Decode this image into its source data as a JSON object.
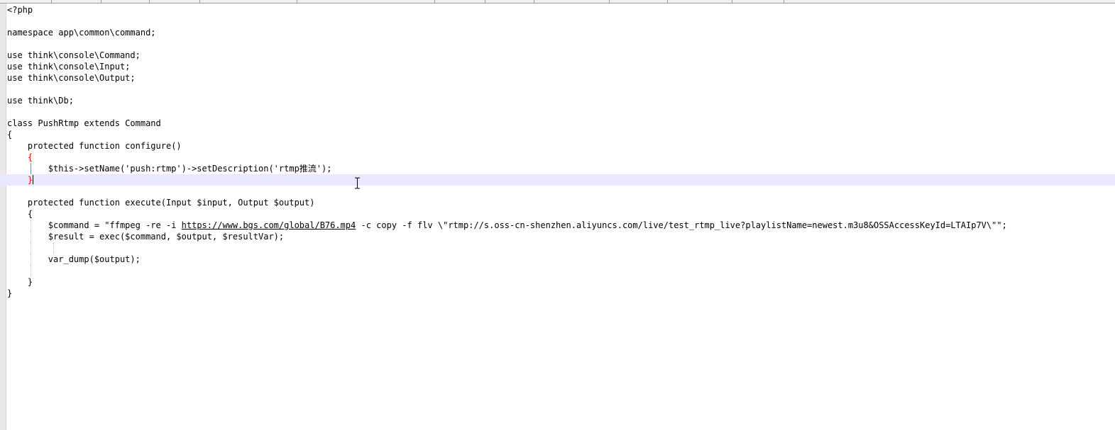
{
  "editor": {
    "language": "PHP",
    "lines": [
      "<?php",
      "",
      "namespace app\\common\\command;",
      "",
      "use think\\console\\Command;",
      "use think\\console\\Input;",
      "use think\\console\\Output;",
      "",
      "use think\\Db;",
      "",
      "class PushRtmp extends Command",
      "{",
      "    protected function configure()",
      "    {",
      "        $this->setName('push:rtmp')->setDescription('rtmp推流');",
      "    }",
      "",
      "    protected function execute(Input $input, Output $output)",
      "    {",
      "        $command = \"ffmpeg -re -i https://www.bgs.com/global/B76.mp4 -c copy -f flv \\\"rtmp://s.oss-cn-shenzhen.aliyuncs.com/live/test_rtmp_live?playlistName=newest.m3u8&OSSAccessKeyId=LTAIp7V\\\"\";",
      "        $result = exec($command, $output, $resultVar);",
      "",
      "        var_dump($output);",
      "",
      "    }",
      "}"
    ],
    "command_line_parts": {
      "indent": "        ",
      "prefix": "$command = \"ffmpeg -re -i ",
      "url": "https://www.bgs.com/global/B76.mp4",
      "suffix": " -c copy -f flv \\\"rtmp://s.oss-cn-shenzhen.aliyuncs.com/live/test_rtmp_live?playlistName=newest.m3u8&OSSAccessKeyId=LTAIp7V\\\"\";"
    },
    "closing_brace_red": "}",
    "opening_brace_red": "{"
  },
  "colors": {
    "background": "#ffffff",
    "current_line": "#e8e8ff",
    "brace_highlight": "#ff0000",
    "text": "#000000"
  }
}
